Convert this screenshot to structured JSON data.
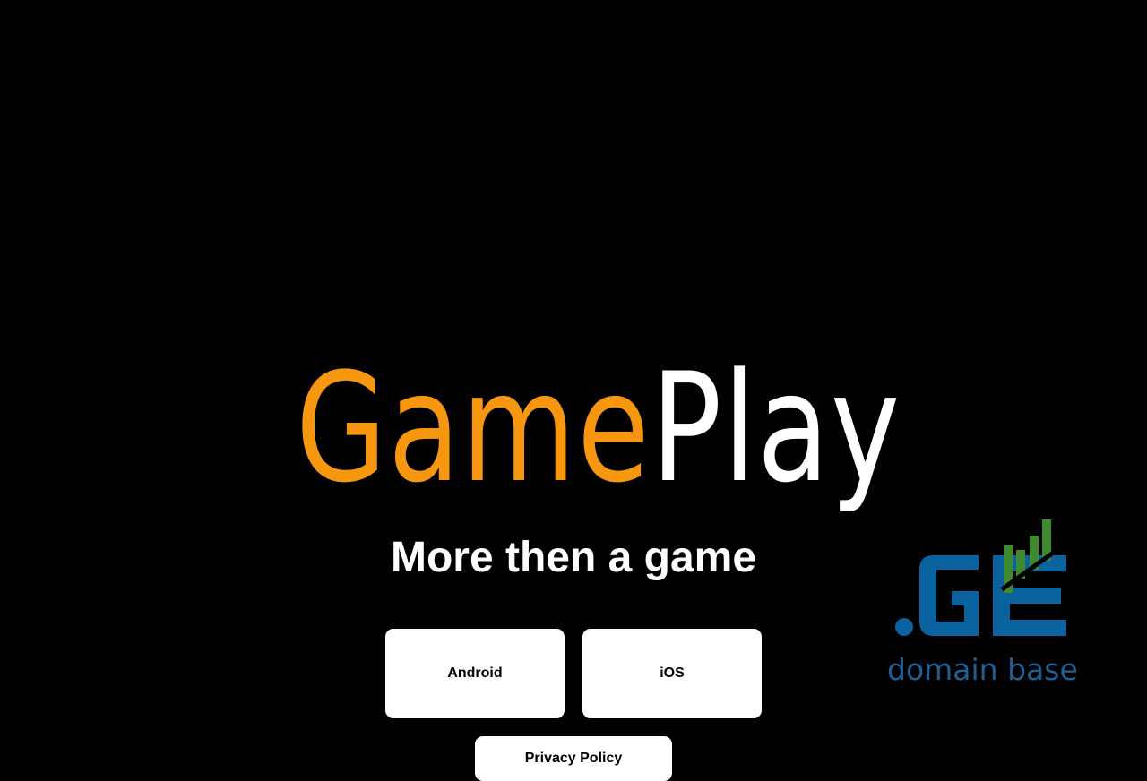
{
  "logo": {
    "part1": "Game",
    "part2": "Play",
    "part1_color": "#F7960F",
    "part2_color": "#FFFFFF"
  },
  "tagline": "More then a game",
  "buttons": {
    "android": "Android",
    "ios": "iOS",
    "privacy": "Privacy Policy"
  },
  "badge": {
    "logo_text": ".GE",
    "subtitle": "domain base",
    "blue": "#0A639E",
    "green": "#3F8A2E",
    "icon": "bar-growth-icon"
  },
  "colors": {
    "background": "#000000",
    "button_bg": "#FFFFFF"
  }
}
